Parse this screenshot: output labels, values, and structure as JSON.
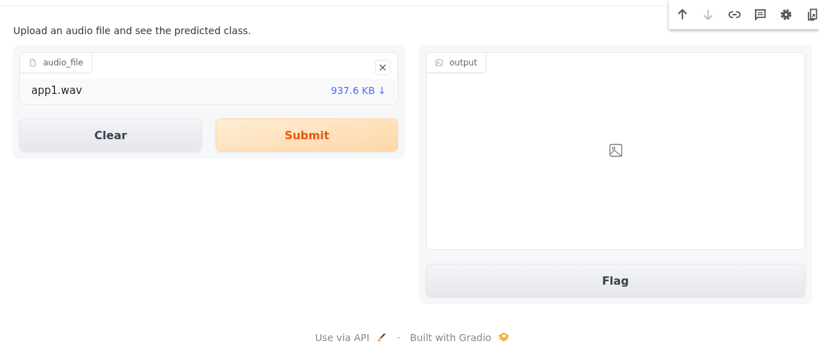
{
  "toolbar": [
    {
      "kind": "up",
      "disabled": false
    },
    {
      "kind": "down",
      "disabled": true
    },
    {
      "kind": "link",
      "disabled": false
    },
    {
      "kind": "comment",
      "disabled": false
    },
    {
      "kind": "settings",
      "disabled": false
    },
    {
      "kind": "popout",
      "disabled": false
    }
  ],
  "description": "Upload an audio file and see the predicted class.",
  "input": {
    "label": "audio_file",
    "file_name": "app1.wav",
    "file_size": "937.6 KB ↓"
  },
  "buttons": [
    {
      "label": "Clear",
      "kind": "secondary"
    },
    {
      "label": "Submit",
      "kind": "primary"
    }
  ],
  "output": {
    "label": "output",
    "flag_button": "Flag"
  },
  "footer": {
    "api_link": "Use via API",
    "separator": "·",
    "built_with": "Built with Gradio"
  }
}
